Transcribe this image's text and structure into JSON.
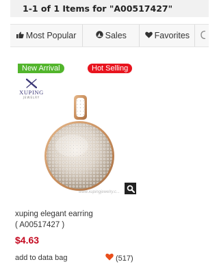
{
  "results": {
    "summary": "1-1 of 1 Items for \"A00517427\""
  },
  "sort_tabs": [
    {
      "label": "Most Popular",
      "icon": "thumbs-up-icon"
    },
    {
      "label": "Sales",
      "icon": "sales-gauge-icon"
    },
    {
      "label": "Favorites",
      "icon": "heart-icon"
    },
    {
      "label": "",
      "icon": "more-icon"
    }
  ],
  "product": {
    "badges": {
      "new": "New Arrival",
      "hot": "Hot Selling"
    },
    "brand": {
      "name": "XUPING",
      "sub": "JEWELRY"
    },
    "watermark": "www.xupingjewelry.c...",
    "name": "xuping elegant earring",
    "sku": "( A00517427 )",
    "price": "$4.63",
    "add_to_bag_label": "add to data bag",
    "favorites_count": "(517)"
  },
  "colors": {
    "new_badge": "#52b52c",
    "hot_badge": "#e8141e",
    "price": "#c4081f",
    "heart": "#e94e1b"
  }
}
